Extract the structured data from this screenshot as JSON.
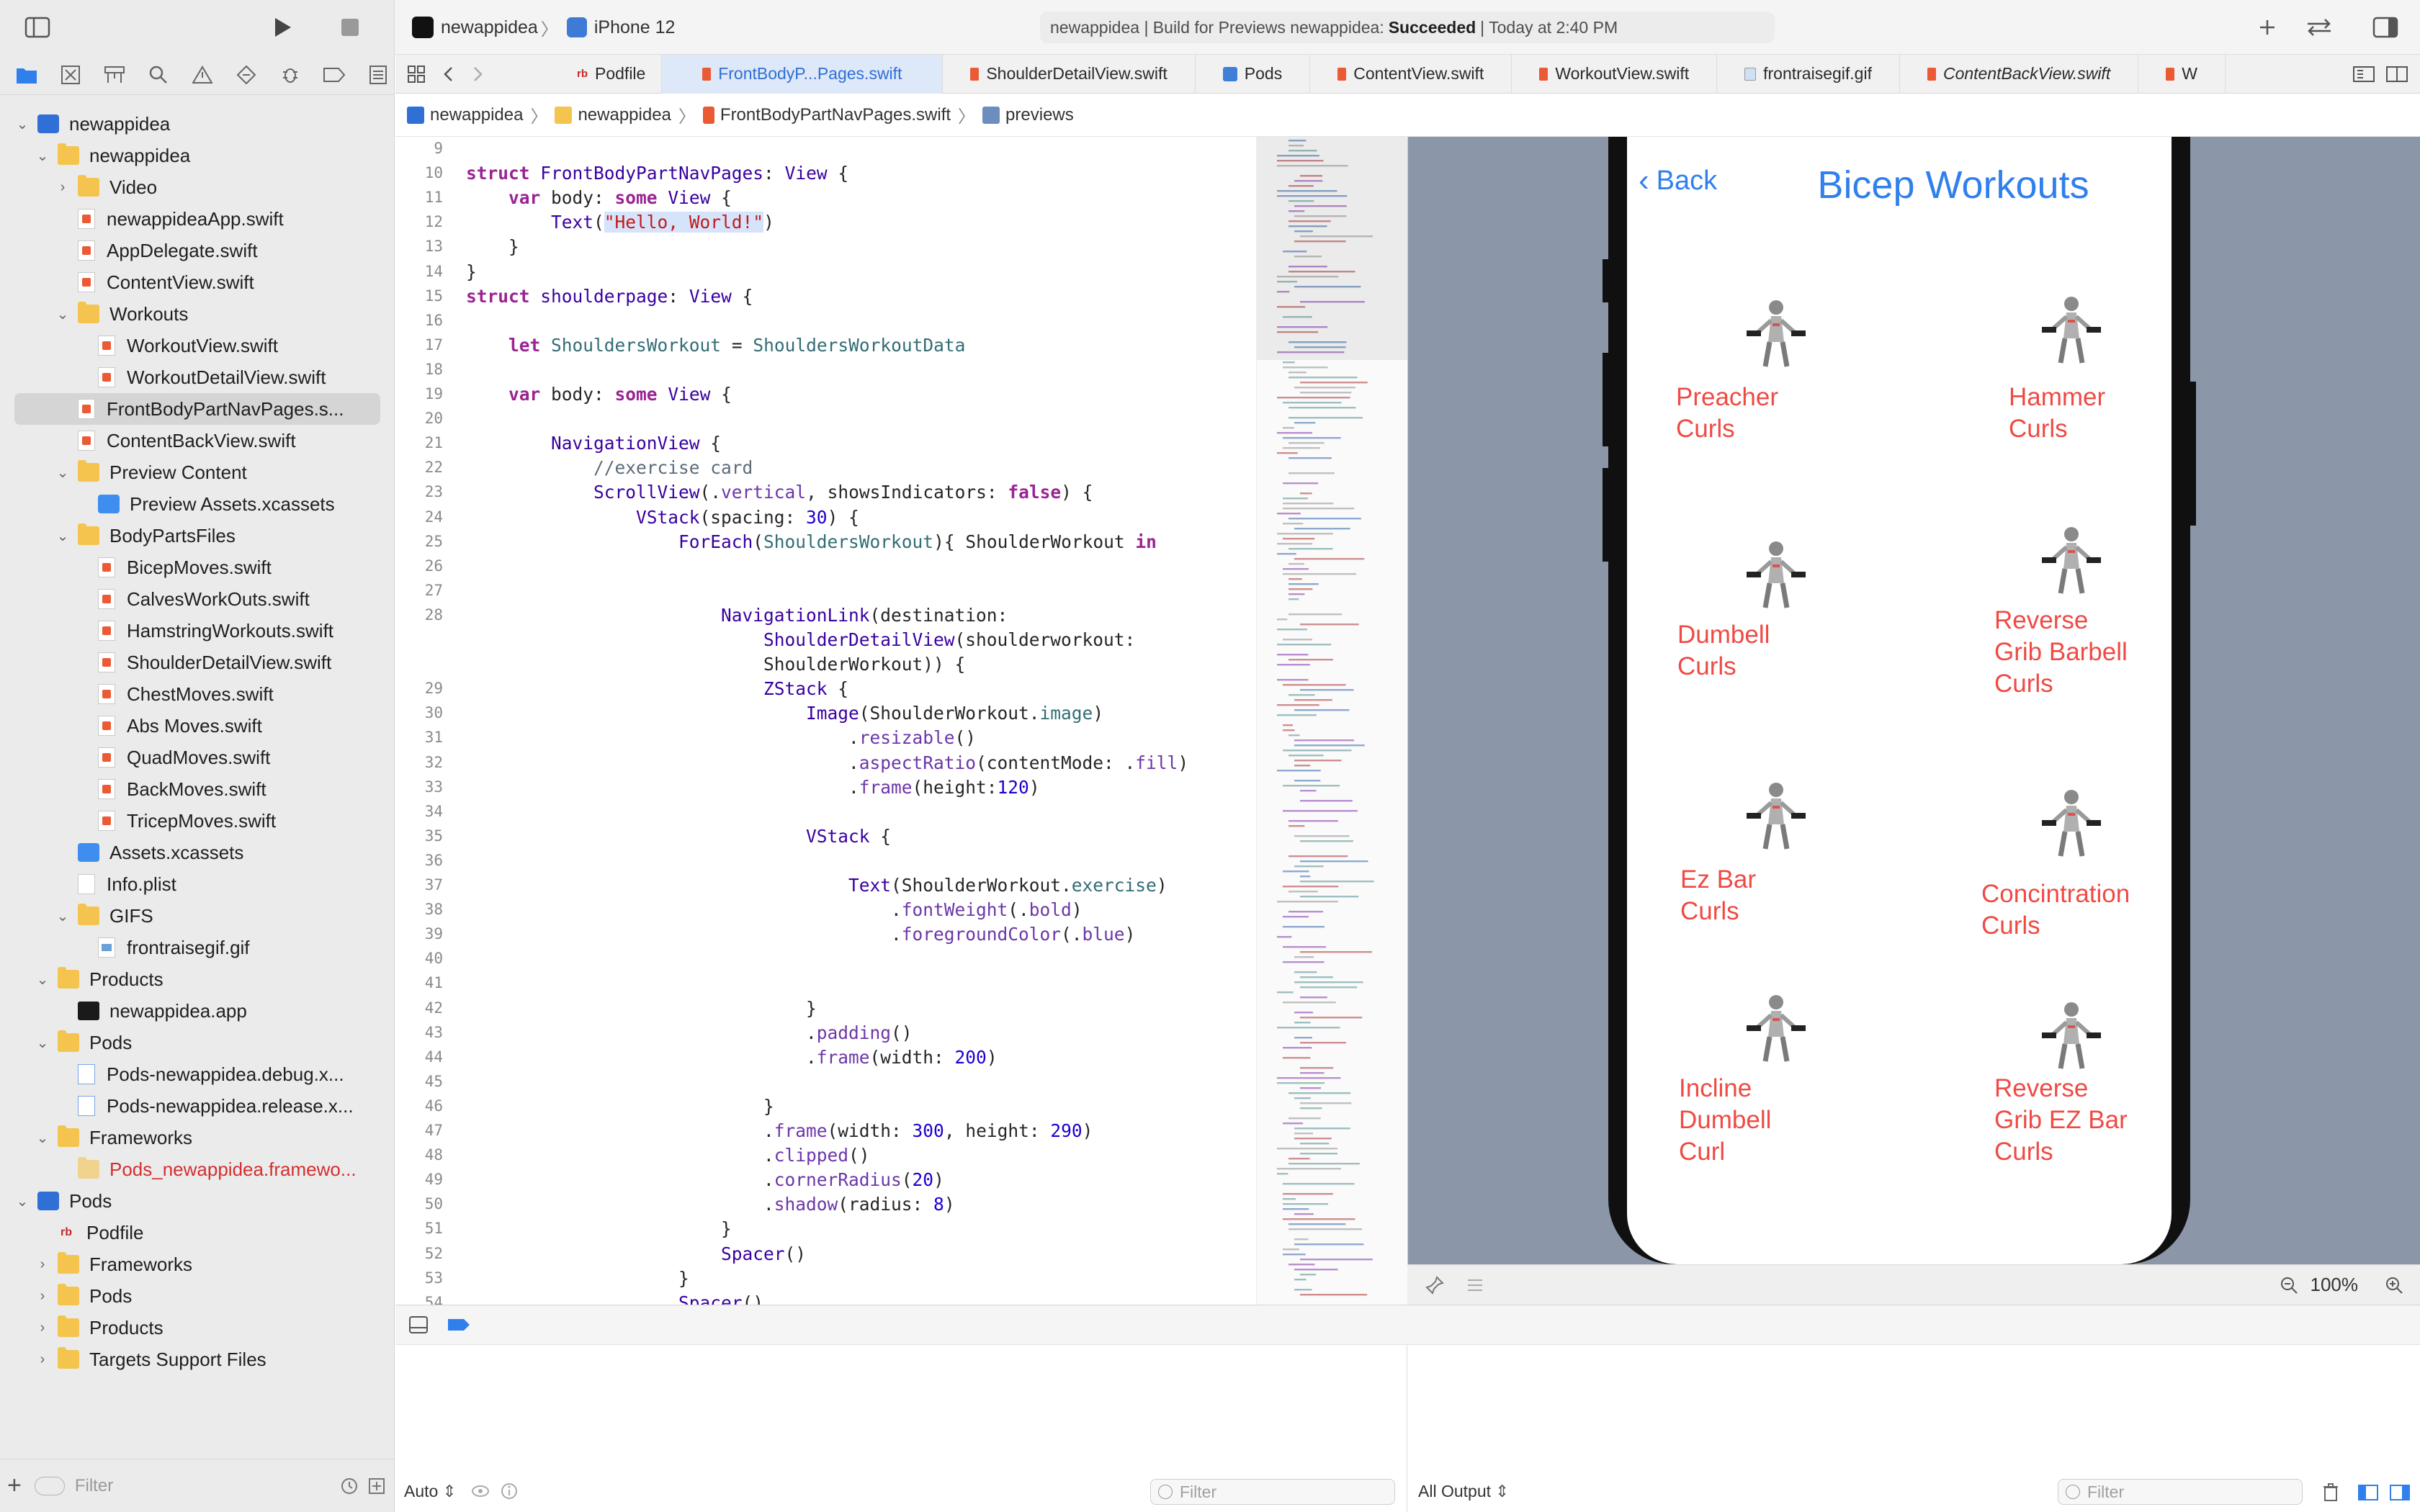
{
  "toolbar": {
    "scheme_project": "newappidea",
    "scheme_device": "iPhone 12",
    "status_prefix": "newappidea | Build for Previews newappidea:",
    "status_result": "Succeeded",
    "status_time": "| Today at 2:40 PM"
  },
  "navigator": {
    "items": [
      {
        "label": "newappidea",
        "indent": 0,
        "icon": "project-icon",
        "disclosure": "open"
      },
      {
        "label": "newappidea",
        "indent": 1,
        "icon": "folder-icon",
        "disclosure": "open"
      },
      {
        "label": "Video",
        "indent": 2,
        "icon": "folder-icon",
        "disclosure": "closed"
      },
      {
        "label": "newappideaApp.swift",
        "indent": 2,
        "icon": "swift-file-icon"
      },
      {
        "label": "AppDelegate.swift",
        "indent": 2,
        "icon": "swift-file-icon"
      },
      {
        "label": "ContentView.swift",
        "indent": 2,
        "icon": "swift-file-icon"
      },
      {
        "label": "Workouts",
        "indent": 2,
        "icon": "folder-icon",
        "disclosure": "open"
      },
      {
        "label": "WorkoutView.swift",
        "indent": 3,
        "icon": "swift-file-icon"
      },
      {
        "label": "WorkoutDetailView.swift",
        "indent": 3,
        "icon": "swift-file-icon"
      },
      {
        "label": "FrontBodyPartNavPages.s...",
        "indent": 2,
        "icon": "swift-file-icon",
        "selected": true
      },
      {
        "label": "ContentBackView.swift",
        "indent": 2,
        "icon": "swift-file-icon"
      },
      {
        "label": "Preview Content",
        "indent": 2,
        "icon": "folder-icon",
        "disclosure": "open"
      },
      {
        "label": "Preview Assets.xcassets",
        "indent": 3,
        "icon": "asset-catalog-icon"
      },
      {
        "label": "BodyPartsFiles",
        "indent": 2,
        "icon": "folder-icon",
        "disclosure": "open"
      },
      {
        "label": "BicepMoves.swift",
        "indent": 3,
        "icon": "swift-file-icon"
      },
      {
        "label": "CalvesWorkOuts.swift",
        "indent": 3,
        "icon": "swift-file-icon"
      },
      {
        "label": "HamstringWorkouts.swift",
        "indent": 3,
        "icon": "swift-file-icon"
      },
      {
        "label": "ShoulderDetailView.swift",
        "indent": 3,
        "icon": "swift-file-icon"
      },
      {
        "label": "ChestMoves.swift",
        "indent": 3,
        "icon": "swift-file-icon"
      },
      {
        "label": "Abs Moves.swift",
        "indent": 3,
        "icon": "swift-file-icon"
      },
      {
        "label": "QuadMoves.swift",
        "indent": 3,
        "icon": "swift-file-icon"
      },
      {
        "label": "BackMoves.swift",
        "indent": 3,
        "icon": "swift-file-icon"
      },
      {
        "label": "TricepMoves.swift",
        "indent": 3,
        "icon": "swift-file-icon"
      },
      {
        "label": "Assets.xcassets",
        "indent": 2,
        "icon": "asset-catalog-icon"
      },
      {
        "label": "Info.plist",
        "indent": 2,
        "icon": "plist-file-icon"
      },
      {
        "label": "GIFS",
        "indent": 2,
        "icon": "folder-icon",
        "disclosure": "open"
      },
      {
        "label": "frontraisegif.gif",
        "indent": 3,
        "icon": "gif-file-icon"
      },
      {
        "label": "Products",
        "indent": 1,
        "icon": "folder-icon",
        "disclosure": "open"
      },
      {
        "label": "newappidea.app",
        "indent": 2,
        "icon": "app-product-icon"
      },
      {
        "label": "Pods",
        "indent": 1,
        "icon": "folder-icon",
        "disclosure": "open"
      },
      {
        "label": "Pods-newappidea.debug.x...",
        "indent": 2,
        "icon": "xcconfig-file-icon"
      },
      {
        "label": "Pods-newappidea.release.x...",
        "indent": 2,
        "icon": "xcconfig-file-icon"
      },
      {
        "label": "Frameworks",
        "indent": 1,
        "icon": "folder-icon",
        "disclosure": "open"
      },
      {
        "label": "Pods_newappidea.framewo...",
        "indent": 2,
        "icon": "framework-icon",
        "missing": true
      },
      {
        "label": "Pods",
        "indent": 0,
        "icon": "project-icon",
        "disclosure": "open"
      },
      {
        "label": "Podfile",
        "indent": 1,
        "icon": "podfile-icon"
      },
      {
        "label": "Frameworks",
        "indent": 1,
        "icon": "folder-icon",
        "disclosure": "closed"
      },
      {
        "label": "Pods",
        "indent": 1,
        "icon": "folder-icon",
        "disclosure": "closed"
      },
      {
        "label": "Products",
        "indent": 1,
        "icon": "folder-icon",
        "disclosure": "closed"
      },
      {
        "label": "Targets Support Files",
        "indent": 1,
        "icon": "folder-icon",
        "disclosure": "closed"
      }
    ],
    "filter_placeholder": "Filter"
  },
  "editor_tabs": [
    {
      "label": "Podfile",
      "icon": "podfile-icon"
    },
    {
      "label": "FrontBodyP...Pages.swift",
      "icon": "swift-file-icon",
      "active": true
    },
    {
      "label": "ShoulderDetailView.swift",
      "icon": "swift-file-icon"
    },
    {
      "label": "Pods",
      "icon": "project-icon"
    },
    {
      "label": "ContentView.swift",
      "icon": "swift-file-icon"
    },
    {
      "label": "WorkoutView.swift",
      "icon": "swift-file-icon"
    },
    {
      "label": "frontraisegif.gif",
      "icon": "gif-file-icon"
    },
    {
      "label": "ContentBackView.swift",
      "icon": "swift-file-icon",
      "italic": true
    },
    {
      "label": "W",
      "icon": "swift-file-icon"
    }
  ],
  "jumpbar": [
    "newappidea",
    "newappidea",
    "FrontBodyPartNavPages.swift",
    "previews"
  ],
  "code_lines": [
    {
      "n": "9",
      "html": ""
    },
    {
      "n": "10",
      "html": "<span class='kw'>struct</span> <span class='ty'>FrontBodyPartNavPages</span>: <span class='ty'>View</span> {"
    },
    {
      "n": "11",
      "html": "    <span class='kw'>var</span> body: <span class='kw'>some</span> <span class='ty'>View</span> {"
    },
    {
      "n": "12",
      "html": "        <span class='ty'>Text</span>(<span class='str sel'>\"Hello, World!\"</span>)"
    },
    {
      "n": "13",
      "html": "    }"
    },
    {
      "n": "14",
      "html": "}"
    },
    {
      "n": "15",
      "html": "<span class='kw'>struct</span> <span class='ty'>shoulderpage</span>: <span class='ty'>View</span> {"
    },
    {
      "n": "16",
      "html": ""
    },
    {
      "n": "17",
      "html": "    <span class='kw'>let</span> <span class='id'>ShouldersWorkout</span> = <span class='id'>ShouldersWorkoutData</span>"
    },
    {
      "n": "18",
      "html": ""
    },
    {
      "n": "19",
      "html": "    <span class='kw'>var</span> body: <span class='kw'>some</span> <span class='ty'>View</span> {"
    },
    {
      "n": "20",
      "html": ""
    },
    {
      "n": "21",
      "html": "        <span class='ty'>NavigationView</span> {"
    },
    {
      "n": "22",
      "html": "            <span class='cm'>//exercise card</span>"
    },
    {
      "n": "23",
      "html": "            <span class='ty'>ScrollView</span>(.<span class='fn'>vertical</span>, showsIndicators: <span class='kw'>false</span>) {"
    },
    {
      "n": "24",
      "html": "                <span class='ty'>VStack</span>(spacing: <span class='num'>30</span>) {"
    },
    {
      "n": "25",
      "html": "                    <span class='ty'>ForEach</span>(<span class='id'>ShouldersWorkout</span>){ ShoulderWorkout <span class='kw'>in</span>"
    },
    {
      "n": "26",
      "html": ""
    },
    {
      "n": "27",
      "html": ""
    },
    {
      "n": "28",
      "html": "                        <span class='ty'>NavigationLink</span>(destination:"
    },
    {
      "n": "",
      "html": "                            <span class='ty'>ShoulderDetailView</span>(shoulderworkout:"
    },
    {
      "n": "",
      "html": "                            ShoulderWorkout)) {"
    },
    {
      "n": "29",
      "html": "                            <span class='ty'>ZStack</span> {"
    },
    {
      "n": "30",
      "html": "                                <span class='ty'>Image</span>(ShoulderWorkout.<span class='id'>image</span>)"
    },
    {
      "n": "31",
      "html": "                                    .<span class='fn'>resizable</span>()"
    },
    {
      "n": "32",
      "html": "                                    .<span class='fn'>aspectRatio</span>(contentMode: .<span class='fn'>fill</span>)"
    },
    {
      "n": "33",
      "html": "                                    .<span class='fn'>frame</span>(height:<span class='num'>120</span>)"
    },
    {
      "n": "34",
      "html": ""
    },
    {
      "n": "35",
      "html": "                                <span class='ty'>VStack</span> {"
    },
    {
      "n": "36",
      "html": ""
    },
    {
      "n": "37",
      "html": "                                    <span class='ty'>Text</span>(ShoulderWorkout.<span class='id'>exercise</span>)"
    },
    {
      "n": "38",
      "html": "                                        .<span class='fn'>fontWeight</span>(.<span class='fn'>bold</span>)"
    },
    {
      "n": "39",
      "html": "                                        .<span class='fn'>foregroundColor</span>(.<span class='fn'>blue</span>)"
    },
    {
      "n": "40",
      "html": ""
    },
    {
      "n": "41",
      "html": ""
    },
    {
      "n": "42",
      "html": "                                }"
    },
    {
      "n": "43",
      "html": "                                .<span class='fn'>padding</span>()"
    },
    {
      "n": "44",
      "html": "                                .<span class='fn'>frame</span>(width: <span class='num'>200</span>)"
    },
    {
      "n": "45",
      "html": ""
    },
    {
      "n": "46",
      "html": "                            }"
    },
    {
      "n": "47",
      "html": "                            .<span class='fn'>frame</span>(width: <span class='num'>300</span>, height: <span class='num'>290</span>)"
    },
    {
      "n": "48",
      "html": "                            .<span class='fn'>clipped</span>()"
    },
    {
      "n": "49",
      "html": "                            .<span class='fn'>cornerRadius</span>(<span class='num'>20</span>)"
    },
    {
      "n": "50",
      "html": "                            .<span class='fn'>shadow</span>(radius: <span class='num'>8</span>)"
    },
    {
      "n": "51",
      "html": "                        }"
    },
    {
      "n": "52",
      "html": "                        <span class='ty'>Spacer</span>()"
    },
    {
      "n": "53",
      "html": "                    }"
    },
    {
      "n": "54",
      "html": "                    <span class='ty'>Spacer</span>()"
    }
  ],
  "preview": {
    "back_label": "Back",
    "title": "Bicep Workouts",
    "workouts": [
      {
        "label": "Preacher\nCurls"
      },
      {
        "label": "Hammer\nCurls"
      },
      {
        "label": "Dumbell\nCurls"
      },
      {
        "label": "Reverse\nGrib Barbell\nCurls"
      },
      {
        "label": "Ez Bar\nCurls"
      },
      {
        "label": "Concintration\nCurls"
      },
      {
        "label": "Incline\nDumbell\nCurl"
      },
      {
        "label": "Reverse\nGrib EZ Bar\nCurls"
      }
    ],
    "zoom": "100%"
  },
  "debug": {
    "mode": "Auto",
    "variables_filter_placeholder": "Filter",
    "output_selector": "All Output",
    "console_filter_placeholder": "Filter"
  },
  "colors": {
    "accent_blue": "#2f80ed",
    "workout_label_red": "#ef4a44",
    "canvas_background": "#8b96a8",
    "status_success_text": "#1f1f1f"
  }
}
